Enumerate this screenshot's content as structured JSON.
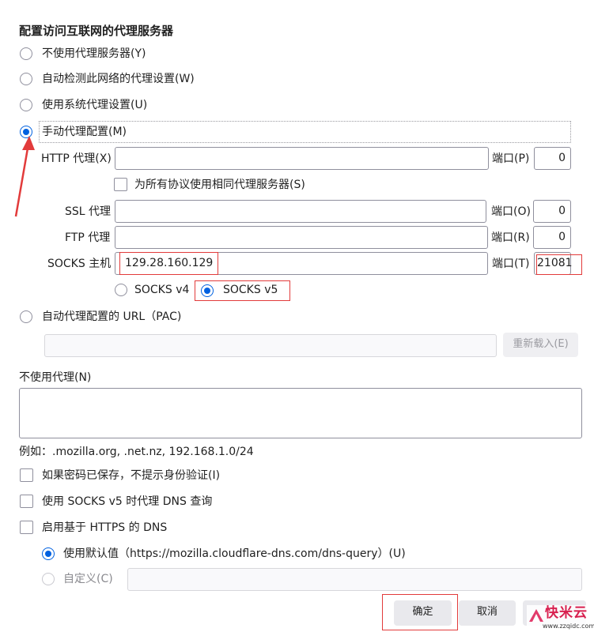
{
  "title": "配置访问互联网的代理服务器",
  "options": {
    "no_proxy": "不使用代理服务器(Y)",
    "auto_detect": "自动检测此网络的代理设置(W)",
    "system": "使用系统代理设置(U)",
    "manual": "手动代理配置(M)",
    "pac": "自动代理配置的 URL（PAC)"
  },
  "http": {
    "label": "HTTP 代理(X)",
    "value": "",
    "port_label": "端口(P)",
    "port": "0"
  },
  "same_proxy": "为所有协议使用相同代理服务器(S)",
  "ssl": {
    "label": "SSL 代理",
    "value": "",
    "port_label": "端口(O)",
    "port": "0"
  },
  "ftp": {
    "label": "FTP 代理",
    "value": "",
    "port_label": "端口(R)",
    "port": "0"
  },
  "socks": {
    "label": "SOCKS 主机",
    "value": "129.28.160.129",
    "port_label": "端口(T)",
    "port": "21081",
    "v4": "SOCKS v4",
    "v5": "SOCKS v5"
  },
  "pac_url": "",
  "reload_button": "重新载入(E)",
  "no_proxy_for": {
    "label": "不使用代理(N)",
    "value": "",
    "example": "例如：.mozilla.org, .net.nz, 192.168.1.0/24"
  },
  "checkboxes": {
    "no_auth_prompt": "如果密码已保存，不提示身份验证(I)",
    "socks_dns": "使用 SOCKS v5 时代理 DNS 查询",
    "https_dns": "启用基于 HTTPS 的 DNS"
  },
  "dns": {
    "default": "使用默认值（https://mozilla.cloudflare-dns.com/dns-query）(U)",
    "custom": "自定义(C)",
    "custom_value": ""
  },
  "buttons": {
    "ok": "确定",
    "cancel": "取消"
  },
  "watermark": {
    "brand": "快米云",
    "domain": "www.zzqidc.com"
  },
  "colors": {
    "accent": "#0061e0",
    "annotation": "#e23b3b"
  }
}
